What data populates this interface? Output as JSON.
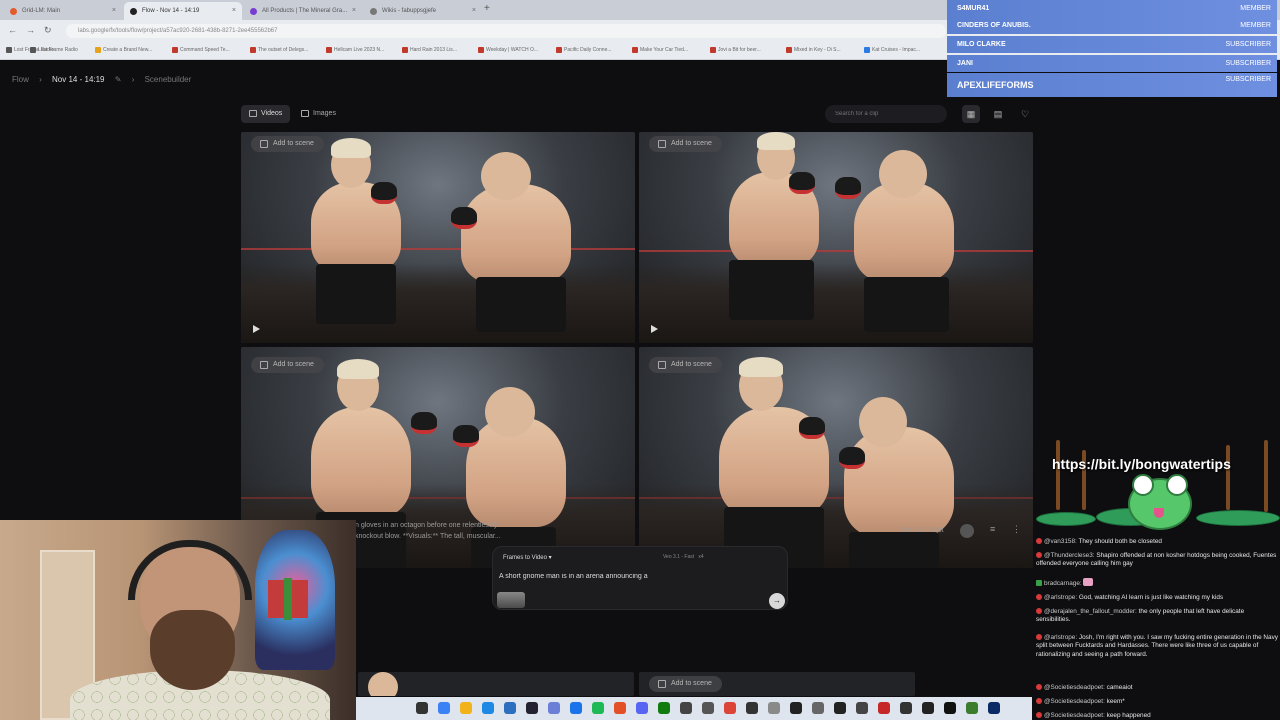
{
  "browser": {
    "tabs": [
      {
        "title": "Grid-LM: Main",
        "color": "#e35a2d"
      },
      {
        "title": "Flow - Nov 14 - 14:19",
        "color": "#222222"
      },
      {
        "title": "All Products | The Mineral Gra...",
        "color": "#7a3cd0"
      },
      {
        "title": "Wikis - fabuppsgjefe",
        "color": "#777777"
      }
    ],
    "url": "labs.google/fx/tools/flow/project/a57ac920-2681-438b-8271-2ee455562b67",
    "bookmarks": [
      {
        "label": "Lost Frame Radio",
        "color": "#555555"
      },
      {
        "label": "Create a Brand New...",
        "color": "#e6a21a"
      },
      {
        "label": "Command Speed Te...",
        "color": "#c0392b"
      },
      {
        "label": "The outset of Delegs...",
        "color": "#c0392b"
      },
      {
        "label": "Hellcam Live 2023 N...",
        "color": "#c0392b"
      },
      {
        "label": "Hard Rain 2013 Lis...",
        "color": "#c0392b"
      },
      {
        "label": "Weekday | WATCH O...",
        "color": "#c0392b"
      },
      {
        "label": "Pacific Daily Conne...",
        "color": "#c0392b"
      },
      {
        "label": "Make Your Car Tied...",
        "color": "#c0392b"
      },
      {
        "label": "Jovi a Bit for beer...",
        "color": "#c0392b"
      },
      {
        "label": "Mixed in Key - Di S...",
        "color": "#c0392b"
      },
      {
        "label": "Kat Cruises - Impac...",
        "color": "#2a7be4"
      }
    ]
  },
  "flow": {
    "breadcrumb": {
      "root": "Flow",
      "project": "Nov 14 - 14:19",
      "section": "Scenebuilder"
    },
    "tabs": {
      "videos": "Videos",
      "images": "Images"
    },
    "search_placeholder": "Search for a clip",
    "add_to_scene": "Add to scene",
    "prompt_excerpt_1": "n gloves in an octagon before one relentlessly",
    "prompt_excerpt_2": "knockout blow. **Visuals:** The tall, muscular...",
    "model_label": "Veo 3.1 - Fast",
    "composer": {
      "mode": "Frames to Video",
      "model": "Veo 3.1 - Fast",
      "count": "x4",
      "text": "A short gnome man is in an arena announcing a"
    }
  },
  "alerts": [
    {
      "name": "S4MUR41",
      "role": "MEMBER"
    },
    {
      "name": "CINDERS OF ANUBIS.",
      "role": "MEMBER"
    },
    {
      "name": "MILO CLARKE",
      "role": "SUBSCRIBER"
    },
    {
      "name": "JANI",
      "role": "SUBSCRIBER"
    },
    {
      "name": "APEXLIFEFORMS",
      "role": "SUBSCRIBER"
    }
  ],
  "overlay_link": "https://bit.ly/bongwatertips",
  "chat": [
    {
      "user": "@van3158:",
      "text": "They should both be closeted"
    },
    {
      "user": "@Thunderclese3:",
      "text": "Shapiro offended at non kosher hotdogs being cooked, Fuentes offended everyone calling him gay"
    },
    {
      "user": "bradcarnage:",
      "text": "",
      "badge": "green"
    },
    {
      "user": "@arlstrope:",
      "text": "God, watching AI learn is just like watching my kids"
    },
    {
      "user": "@derajalen_the_fallout_modder:",
      "text": "the only people that left have delicate sensibilities."
    },
    {
      "user": "@arlstrope:",
      "text": "Josh, I'm right with you. I saw my fucking entire generation in the Navy split between Fucktards and Hardasses. There were like three of us capable of rationalizing and seeing a path forward."
    },
    {
      "user": "@Societiesdeadpoet:",
      "text": "cameaiot"
    },
    {
      "user": "@Societiesdeadpoet:",
      "text": "keem*"
    },
    {
      "user": "@Societiesdeadpoet:",
      "text": "keep happened"
    }
  ]
}
